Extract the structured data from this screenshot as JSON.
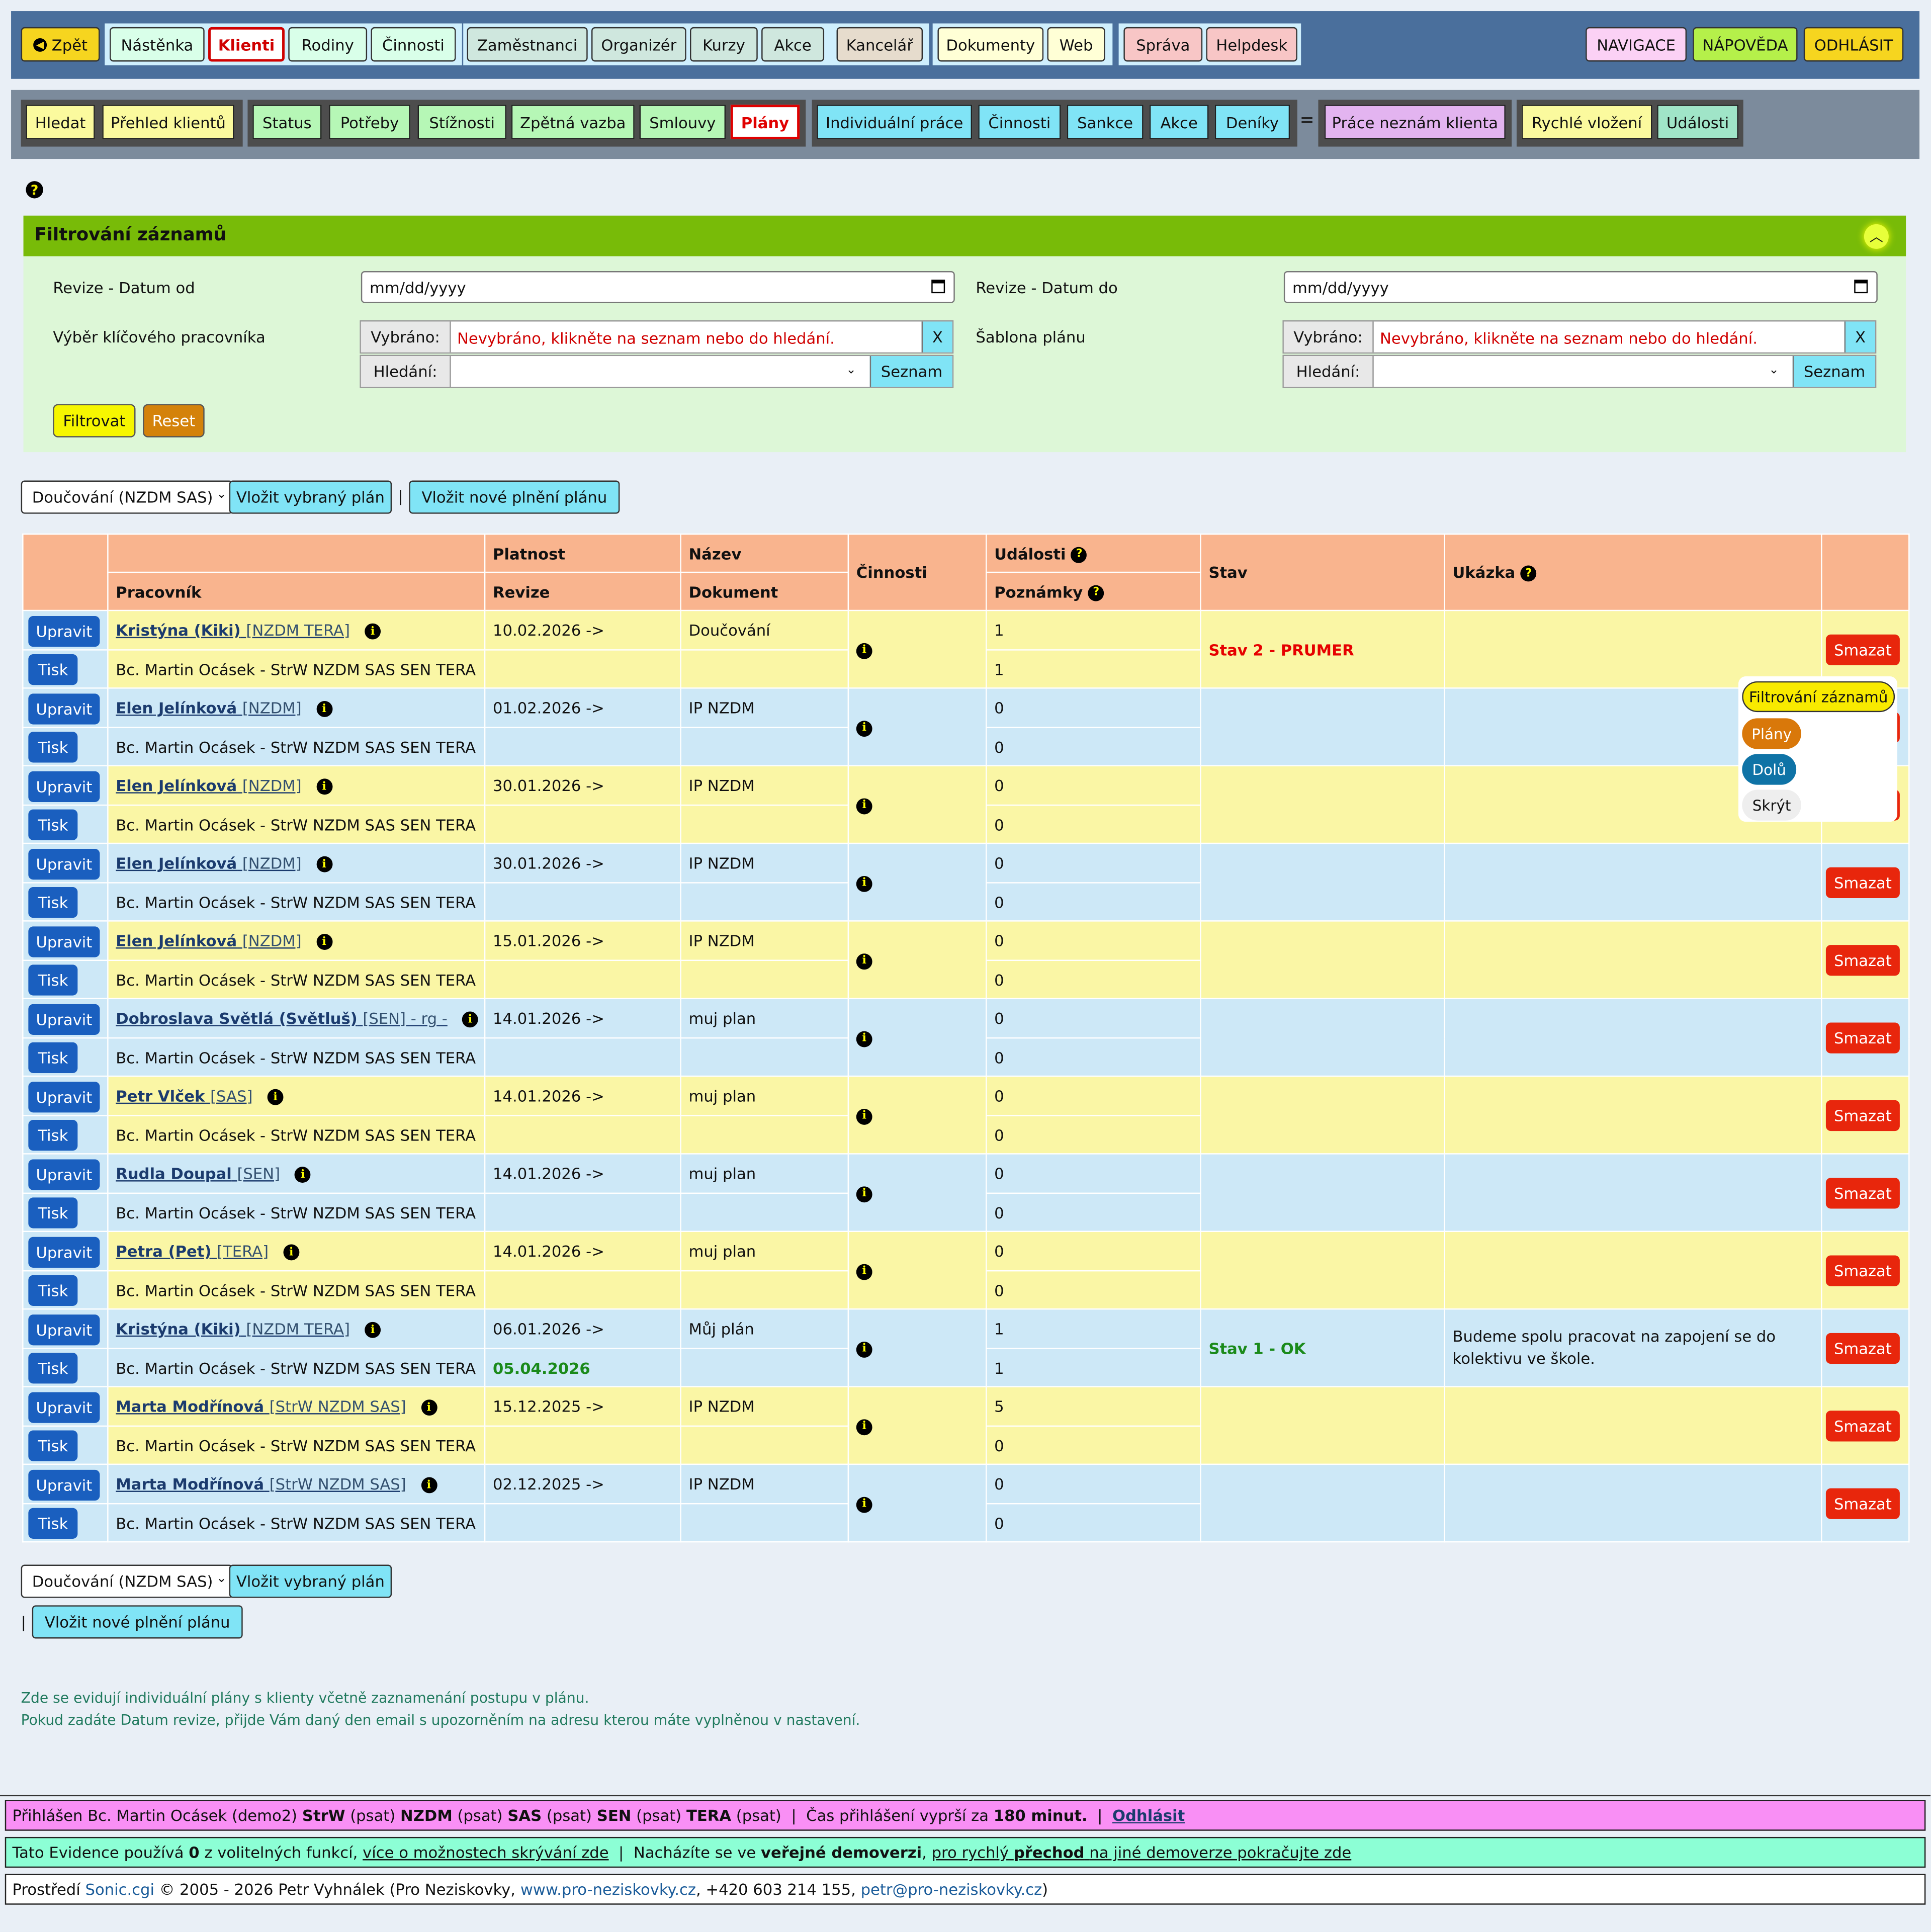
{
  "topnav": {
    "back": "Zpět",
    "items": [
      "Nástěnka",
      "Klienti",
      "Rodiny",
      "Činnosti",
      "Zaměstnanci",
      "Organizér",
      "Kurzy",
      "Akce",
      "Kancelář",
      "Dokumenty",
      "Web",
      "Správa",
      "Helpdesk"
    ],
    "right": [
      "NAVIGACE",
      "NÁPOVĚDA",
      "ODHLÁSIT"
    ]
  },
  "subnav": {
    "items": [
      "Hledat",
      "Přehled klientů",
      "Status",
      "Potřeby",
      "Stížnosti",
      "Zpětná vazba",
      "Smlouvy",
      "Plány",
      "Individuální práce",
      "Činnosti",
      "Sankce",
      "Akce",
      "Deníky",
      "Práce neznám klienta",
      "Rychlé vložení",
      "Události"
    ],
    "separator": "="
  },
  "filter": {
    "title": "Filtrování záznamů",
    "date_from_label": "Revize - Datum od",
    "date_to_label": "Revize - Datum do",
    "date_placeholder": "mm/dd/yyyy",
    "worker_label": "Výběr klíčového pracovníka",
    "template_label": "Šablona plánu",
    "selected_label": "Vybráno:",
    "selected_value": "Nevybráno, klikněte na seznam nebo do hledání.",
    "clear": "X",
    "search_label": "Hledání:",
    "list_btn": "Seznam",
    "filter_btn": "Filtrovat",
    "reset_btn": "Reset"
  },
  "plan_select": {
    "value": "Doučování (NZDM SAS)",
    "insert_selected": "Vložit vybraný plán",
    "pipe": "|",
    "insert_new": "Vložit nové plnění plánu"
  },
  "table": {
    "headers": {
      "platnost": "Platnost",
      "revize": "Revize",
      "pracovnik": "Pracovník",
      "nazev": "Název",
      "dokument": "Dokument",
      "cinnosti": "Činnosti",
      "udalosti": "Události",
      "poznamky": "Poznámky",
      "stav": "Stav",
      "ukazka": "Ukázka"
    },
    "edit_btn": "Upravit",
    "print_btn": "Tisk",
    "delete_btn": "Smazat",
    "rows": [
      {
        "client": "Kristýna (Kiki)",
        "tag": "[NZDM TERA]",
        "worker": "Bc. Martin Ocásek - StrW NZDM SAS SEN TERA",
        "platnost": "10.02.2026 ->",
        "revize": "",
        "nazev": "Doučování",
        "udalosti": "1",
        "poznamky": "1",
        "stav": "Stav 2 - PRUMER",
        "stav_color": "red",
        "ukazka": ""
      },
      {
        "client": "Elen Jelínková",
        "tag": "[NZDM]",
        "worker": "Bc. Martin Ocásek - StrW NZDM SAS SEN TERA",
        "platnost": "01.02.2026 ->",
        "revize": "",
        "nazev": "IP NZDM",
        "udalosti": "0",
        "poznamky": "0",
        "stav": "",
        "stav_color": "",
        "ukazka": ""
      },
      {
        "client": "Elen Jelínková",
        "tag": "[NZDM]",
        "worker": "Bc. Martin Ocásek - StrW NZDM SAS SEN TERA",
        "platnost": "30.01.2026 ->",
        "revize": "",
        "nazev": "IP NZDM",
        "udalosti": "0",
        "poznamky": "0",
        "stav": "",
        "stav_color": "",
        "ukazka": ""
      },
      {
        "client": "Elen Jelínková",
        "tag": "[NZDM]",
        "worker": "Bc. Martin Ocásek - StrW NZDM SAS SEN TERA",
        "platnost": "30.01.2026 ->",
        "revize": "",
        "nazev": "IP NZDM",
        "udalosti": "0",
        "poznamky": "0",
        "stav": "",
        "stav_color": "",
        "ukazka": ""
      },
      {
        "client": "Elen Jelínková",
        "tag": "[NZDM]",
        "worker": "Bc. Martin Ocásek - StrW NZDM SAS SEN TERA",
        "platnost": "15.01.2026 ->",
        "revize": "",
        "nazev": "IP NZDM",
        "udalosti": "0",
        "poznamky": "0",
        "stav": "",
        "stav_color": "",
        "ukazka": ""
      },
      {
        "client": "Dobroslava Světlá (Světluš)",
        "tag": "[SEN] - rg -",
        "worker": "Bc. Martin Ocásek - StrW NZDM SAS SEN TERA",
        "platnost": "14.01.2026 ->",
        "revize": "",
        "nazev": "muj plan",
        "udalosti": "0",
        "poznamky": "0",
        "stav": "",
        "stav_color": "",
        "ukazka": ""
      },
      {
        "client": "Petr Vlček",
        "tag": "[SAS]",
        "worker": "Bc. Martin Ocásek - StrW NZDM SAS SEN TERA",
        "platnost": "14.01.2026 ->",
        "revize": "",
        "nazev": "muj plan",
        "udalosti": "0",
        "poznamky": "0",
        "stav": "",
        "stav_color": "",
        "ukazka": ""
      },
      {
        "client": "Rudla Doupal",
        "tag": "[SEN]",
        "worker": "Bc. Martin Ocásek - StrW NZDM SAS SEN TERA",
        "platnost": "14.01.2026 ->",
        "revize": "",
        "nazev": "muj plan",
        "udalosti": "0",
        "poznamky": "0",
        "stav": "",
        "stav_color": "",
        "ukazka": ""
      },
      {
        "client": "Petra (Pet)",
        "tag": "[TERA]",
        "worker": "Bc. Martin Ocásek - StrW NZDM SAS SEN TERA",
        "platnost": "14.01.2026 ->",
        "revize": "",
        "nazev": "muj plan",
        "udalosti": "0",
        "poznamky": "0",
        "stav": "",
        "stav_color": "",
        "ukazka": ""
      },
      {
        "client": "Kristýna (Kiki)",
        "tag": "[NZDM TERA]",
        "worker": "Bc. Martin Ocásek - StrW NZDM SAS SEN TERA",
        "platnost": "06.01.2026 ->",
        "revize": "05.04.2026",
        "nazev": "Můj plán",
        "udalosti": "1",
        "poznamky": "1",
        "stav": "Stav 1 - OK",
        "stav_color": "green",
        "ukazka": "Budeme spolu pracovat na zapojení se do kolektivu ve škole."
      },
      {
        "client": "Marta Modřínová",
        "tag": "[StrW NZDM SAS]",
        "worker": "Bc. Martin Ocásek - StrW NZDM SAS SEN TERA",
        "platnost": "15.12.2025 ->",
        "revize": "",
        "nazev": "IP NZDM",
        "udalosti": "5",
        "poznamky": "0",
        "stav": "",
        "stav_color": "",
        "ukazka": ""
      },
      {
        "client": "Marta Modřínová",
        "tag": "[StrW NZDM SAS]",
        "worker": "Bc. Martin Ocásek - StrW NZDM SAS SEN TERA",
        "platnost": "02.12.2025 ->",
        "revize": "",
        "nazev": "IP NZDM",
        "udalosti": "0",
        "poznamky": "0",
        "stav": "",
        "stav_color": "",
        "ukazka": ""
      }
    ]
  },
  "float_menu": [
    "Filtrování záznamů",
    "Plány",
    "Dolů",
    "Skrýt"
  ],
  "notes": [
    "Zde se evidují individuální plány s klienty včetně zaznamenání postupu v plánu.",
    "Pokud zadáte Datum revize, přijde Vám daný den email s upozorněním na adresu kterou máte vyplněnou v nastavení."
  ],
  "footer": {
    "login_prefix": "Přihlášen Bc. Martin Ocásek (demo2)",
    "roles": [
      [
        "StrW",
        "(psat)"
      ],
      [
        "NZDM",
        "(psat)"
      ],
      [
        "SAS",
        "(psat)"
      ],
      [
        "SEN",
        "(psat)"
      ],
      [
        "TERA",
        "(psat)"
      ]
    ],
    "expire_text": "Čas přihlášení vyprší za",
    "expire_value": "180 minut.",
    "logout": "Odhlásit",
    "info_1": "Tato Evidence používá",
    "info_count": "0",
    "info_2": "z volitelných funkcí,",
    "info_link": "více o možnostech skrývání zde",
    "info_3": "Nacházíte se ve",
    "info_bold": "veřejné demoverzi",
    "info_link2a": "pro rychlý",
    "info_link2b": "přechod",
    "info_link2c": "na jiné demoverze pokračujte zde",
    "copyright_1": "Prostředí",
    "copyright_app": "Sonic.cgi",
    "copyright_2": "© 2005 - 2026 Petr Vyhnálek (Pro Neziskovky,",
    "copyright_web": "www.pro-neziskovky.cz",
    "copyright_3": ", +420 603 214 155,",
    "copyright_mail": "petr@pro-neziskovky.cz",
    "copyright_4": ")"
  },
  "colors": {
    "accent_green": "#78bb08",
    "nav_blue": "#4a6f9c",
    "delete_red": "#e8260c",
    "edit_blue": "#1a5fbf"
  }
}
